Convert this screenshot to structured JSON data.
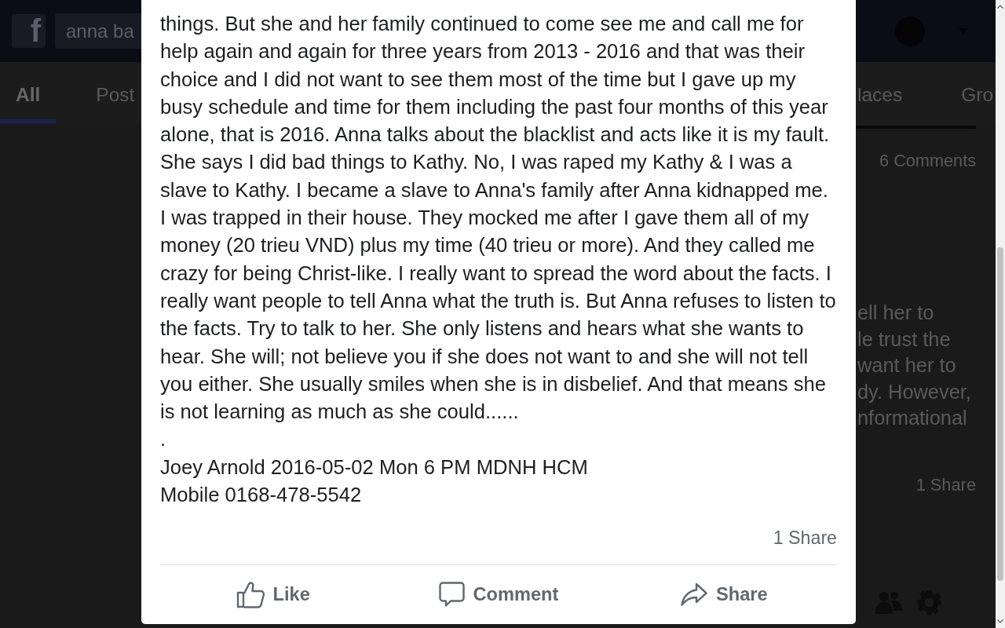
{
  "top_bar": {
    "logo": "f",
    "search": {
      "value": "anna ba"
    }
  },
  "tabs": [
    {
      "label": "All",
      "selected": true
    },
    {
      "label": "Post",
      "selected": false
    },
    {
      "label": "laces",
      "selected": false
    },
    {
      "label": "Gro",
      "selected": false
    }
  ],
  "side_post": {
    "comments": "6 Comments",
    "text_lines": [
      "ell her to",
      "le trust the",
      "want her to",
      "dy. However,",
      "nformational"
    ],
    "shares": "1 Share"
  },
  "modal": {
    "paragraphs": [
      "things. But she and her family continued to come see me and call me for help again and again for three years from 2013 - 2016 and that was their choice and I did not want to see them most of the time but I gave up my busy schedule and time for them including the past four months of this year alone, that is 2016. Anna talks about the blacklist and acts like it is my fault. She says I did bad things to Kathy. No, I was raped my Kathy & I was a slave to Kathy. I became a slave to Anna's family after Anna kidnapped me. I was trapped in their house. They mocked me after I gave them all of my money (20 trieu VND) plus my time (40 trieu or more). And they called me crazy for being Christ-like. I really want to spread the word about the facts. I really want people to tell Anna what the truth is. But Anna refuses to listen to the facts. Try to talk to her. She only listens and hears what she wants to hear. She will; not believe you if she does not want to and she will not tell you either. She usually smiles when she is in disbelief. And that means she is not learning as much as she could......",
      ".",
      "Joey Arnold 2016-05-02 Mon 6 PM MDNH HCM",
      "Mobile 0168-478-5542"
    ],
    "shares": "1 Share",
    "actions": [
      {
        "kind": "like",
        "label": "Like"
      },
      {
        "kind": "comment",
        "label": "Comment"
      },
      {
        "kind": "share",
        "label": "Share"
      }
    ]
  }
}
